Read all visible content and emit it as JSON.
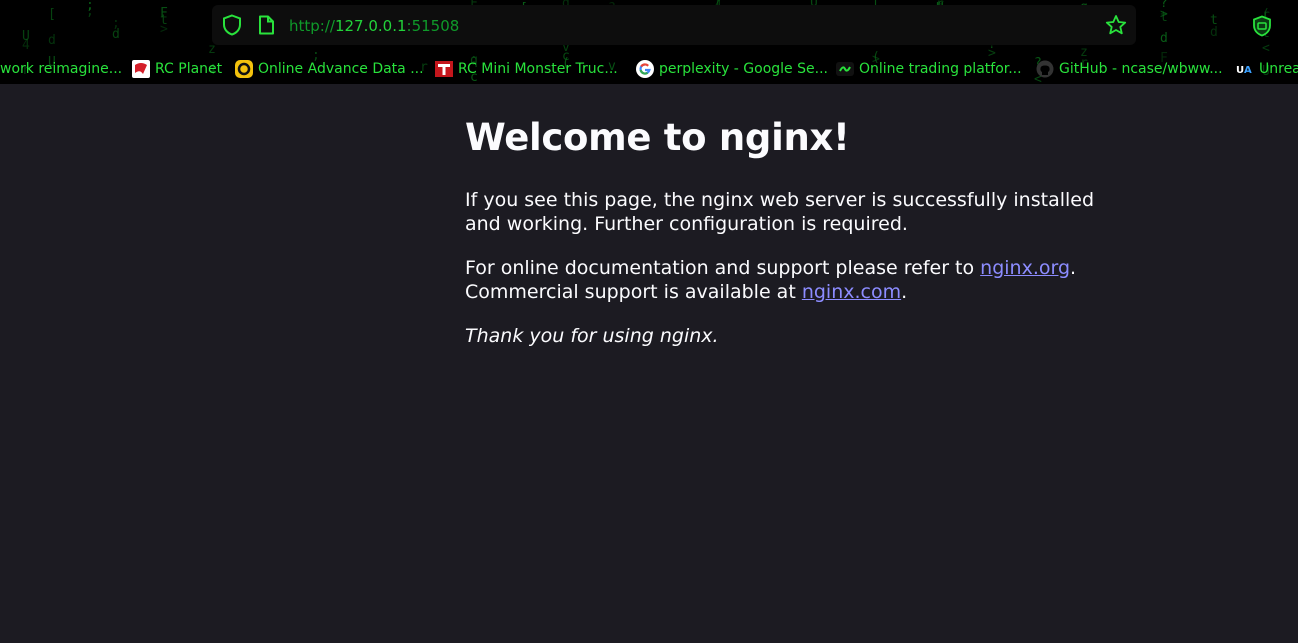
{
  "browser": {
    "url_prefix": "http://",
    "url_host": "127.0.0.1",
    "url_port": ":51508"
  },
  "bookmarks": [
    {
      "label": "work reimagine...",
      "icon": "none"
    },
    {
      "label": "RC Planet",
      "icon": "rc-planet-icon"
    },
    {
      "label": "Online Advance Data ...",
      "icon": "advance-data-icon"
    },
    {
      "label": "RC Mini Monster Truc...",
      "icon": "rc-mini-icon"
    },
    {
      "label": "perplexity - Google Se...",
      "icon": "google-icon"
    },
    {
      "label": "Online trading platfor...",
      "icon": "trading-icon"
    },
    {
      "label": "GitHub - ncase/wbww...",
      "icon": "github-icon"
    },
    {
      "label": "Unrea",
      "icon": "ua-icon"
    }
  ],
  "page": {
    "heading": "Welcome to nginx!",
    "p1": "If you see this page, the nginx web server is successfully installed and working. Further configuration is required.",
    "p2_before_link1": "For online documentation and support please refer to ",
    "link1": "nginx.org",
    "p2_after_link1": ".",
    "p2_line2": "Commercial support is available at ",
    "link2": "nginx.com",
    "p2_after_link2": ".",
    "p3": "Thank you for using nginx."
  },
  "colors": {
    "accent_green": "#29e23c",
    "page_bg": "#1c1b22",
    "link": "#8c8cff"
  }
}
